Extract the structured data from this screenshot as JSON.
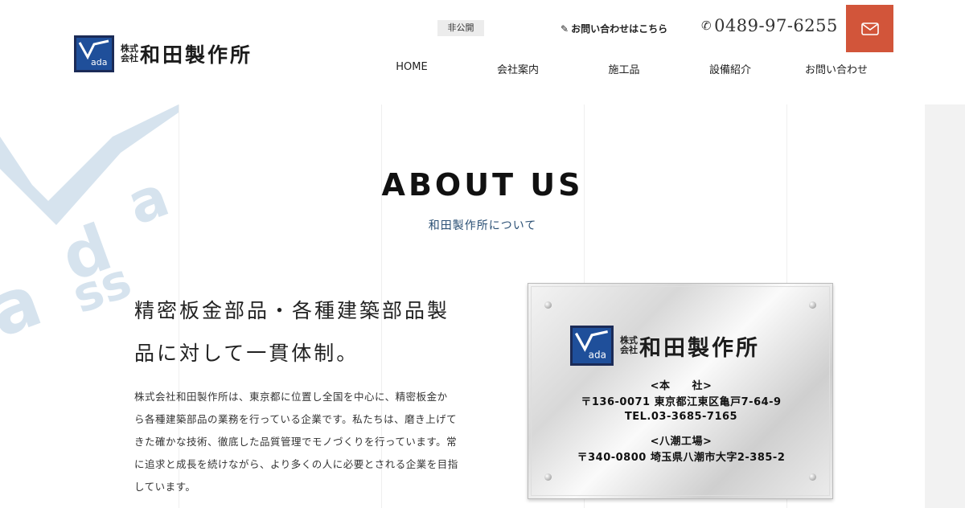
{
  "header": {
    "logo_small": "株式会社",
    "logo_name": "和田製作所",
    "private_badge": "非公開",
    "contact_link": "お問い合わせはこちら",
    "phone": "0489-97-6255",
    "mail_icon": "mail-icon"
  },
  "nav": {
    "items": [
      {
        "label": "HOME"
      },
      {
        "label": "会社案内"
      },
      {
        "label": "施工品"
      },
      {
        "label": "設備紹介"
      },
      {
        "label": "お問い合わせ"
      }
    ]
  },
  "about": {
    "title": "ABOUT US",
    "subtitle": "和田製作所について",
    "headline_line1": "精密板金部品・各種建築部品製",
    "headline_line2": "品に対して一貫体制。",
    "body_lines": [
      "株式会社和田製作所は、東京都に位置し全国を中心に、精密板金か",
      "ら各種建築部品の業務を行っている企業です。私たちは、磨き上げて",
      "きた確かな技術、徹底した品質管理でモノづくりを行っています。常",
      "に追求と成長を続けながら、より多くの人に必要とされる企業を目指",
      "しています。"
    ]
  },
  "plate": {
    "logo_small": "株式会社",
    "logo_name": "和田製作所",
    "hq_label": "<本　　社>",
    "hq_address": "〒136-0071 東京都江東区亀戸7-64-9",
    "hq_tel": "TEL.03-3685-7165",
    "factory_label": "<八潮工場>",
    "factory_address": "〒340-0800 埼玉県八潮市大字2-385-2"
  },
  "colors": {
    "accent": "#d2553a",
    "logo_navy": "#1b2b57",
    "subtitle": "#2a4f74"
  }
}
